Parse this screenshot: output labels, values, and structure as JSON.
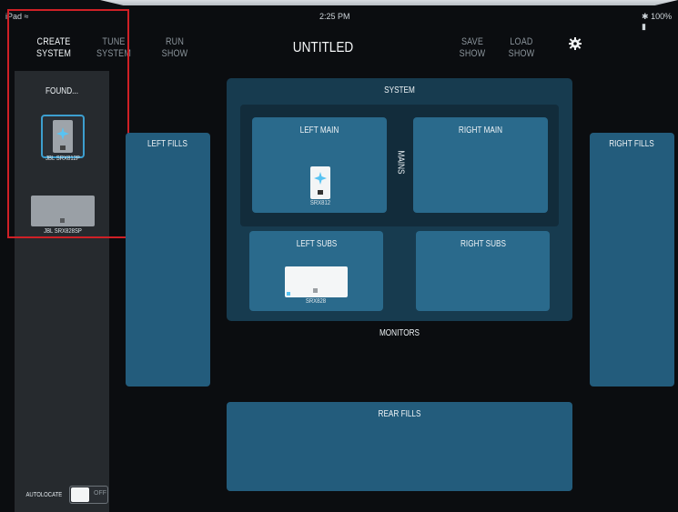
{
  "status_bar": {
    "device": "iPad",
    "time": "2:25 PM",
    "battery": "100%"
  },
  "nav": {
    "create_system": "CREATE\nSYSTEM",
    "tune_system": "TUNE\nSYSTEM",
    "run_show": "RUN\nSHOW",
    "title": "UNTITLED",
    "save_show": "SAVE\nSHOW",
    "load_show": "LOAD\nSHOW"
  },
  "sidebar": {
    "heading": "FOUND...",
    "devices": [
      {
        "label": "JBL SRX812P"
      },
      {
        "label": "JBL SRX828SP"
      }
    ],
    "autolocate_label": "AUTOLOCATE",
    "autolocate_state": "OFF"
  },
  "layout": {
    "system": "SYSTEM",
    "left_main": "LEFT MAIN",
    "right_main": "RIGHT MAIN",
    "mains": "MAINS",
    "left_subs": "LEFT SUBS",
    "right_subs": "RIGHT SUBS",
    "monitors": "MONITORS",
    "left_fills": "LEFT FILLS",
    "right_fills": "RIGHT FILLS",
    "rear_fills": "REAR FILLS",
    "left_main_device": "SRX812",
    "left_sub_device": "SRX828"
  },
  "colors": {
    "panel": "#235c7c",
    "accent_blue": "#3c9fd0",
    "highlight_red": "#cf2026"
  },
  "icons": {
    "wifi": "wifi-icon",
    "bluetooth": "bluetooth-icon",
    "battery": "battery-icon",
    "gear": "gear-icon"
  }
}
